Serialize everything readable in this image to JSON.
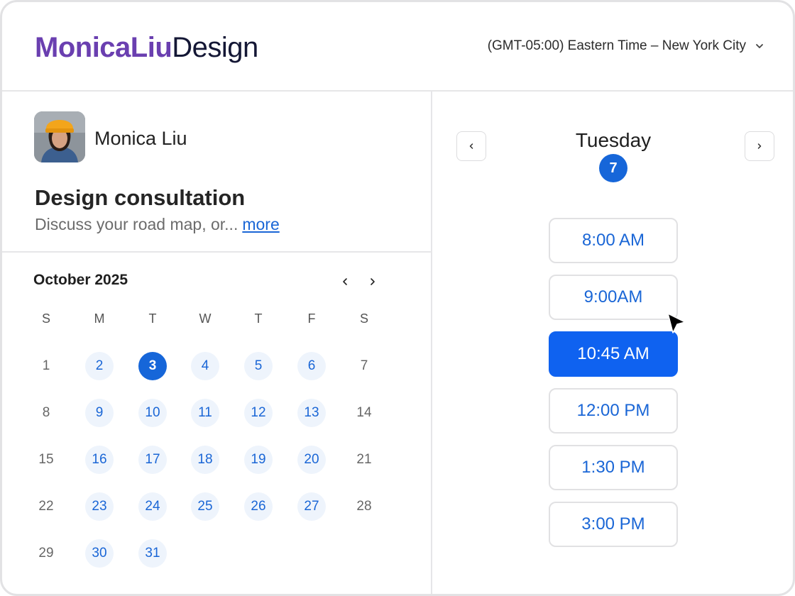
{
  "brand": {
    "part1": "MonicaLiu",
    "part2": "Design"
  },
  "timezone": {
    "label": "(GMT-05:00) Eastern Time – New York City",
    "icon": "chevron-down-icon"
  },
  "host": {
    "name": "Monica Liu",
    "avatar": "avatar-photo"
  },
  "event": {
    "title": "Design consultation",
    "description": "Discuss your road map, or...",
    "more_label": "more"
  },
  "calendar": {
    "month_label": "October 2025",
    "prev_icon": "chevron-left-icon",
    "next_icon": "chevron-right-icon",
    "weekdays": [
      "S",
      "M",
      "T",
      "W",
      "T",
      "F",
      "S"
    ],
    "selected_day": "3",
    "weeks": [
      [
        {
          "d": "1",
          "a": false
        },
        {
          "d": "2",
          "a": true
        },
        {
          "d": "3",
          "a": true
        },
        {
          "d": "4",
          "a": true
        },
        {
          "d": "5",
          "a": true
        },
        {
          "d": "6",
          "a": true
        },
        {
          "d": "7",
          "a": false
        }
      ],
      [
        {
          "d": "8",
          "a": false
        },
        {
          "d": "9",
          "a": true
        },
        {
          "d": "10",
          "a": true
        },
        {
          "d": "11",
          "a": true
        },
        {
          "d": "12",
          "a": true
        },
        {
          "d": "13",
          "a": true
        },
        {
          "d": "14",
          "a": false
        }
      ],
      [
        {
          "d": "15",
          "a": false
        },
        {
          "d": "16",
          "a": true
        },
        {
          "d": "17",
          "a": true
        },
        {
          "d": "18",
          "a": true
        },
        {
          "d": "19",
          "a": true
        },
        {
          "d": "20",
          "a": true
        },
        {
          "d": "21",
          "a": false
        }
      ],
      [
        {
          "d": "22",
          "a": false
        },
        {
          "d": "23",
          "a": true
        },
        {
          "d": "24",
          "a": true
        },
        {
          "d": "25",
          "a": true
        },
        {
          "d": "26",
          "a": true
        },
        {
          "d": "27",
          "a": true
        },
        {
          "d": "28",
          "a": false
        }
      ],
      [
        {
          "d": "29",
          "a": false
        },
        {
          "d": "30",
          "a": true
        },
        {
          "d": "31",
          "a": true
        }
      ]
    ]
  },
  "day_panel": {
    "weekday": "Tuesday",
    "day_number": "7",
    "prev_icon": "chevron-left-icon",
    "next_icon": "chevron-right-icon",
    "selected_slot": "10:45 AM",
    "slots": [
      "8:00 AM",
      "9:00AM",
      "10:45 AM",
      "12:00 PM",
      "1:30 PM",
      "3:00 PM"
    ]
  },
  "colors": {
    "brand_purple": "#6a3fb0",
    "brand_navy": "#141735",
    "accent_blue": "#1666d9",
    "slot_active": "#0f62f0"
  }
}
